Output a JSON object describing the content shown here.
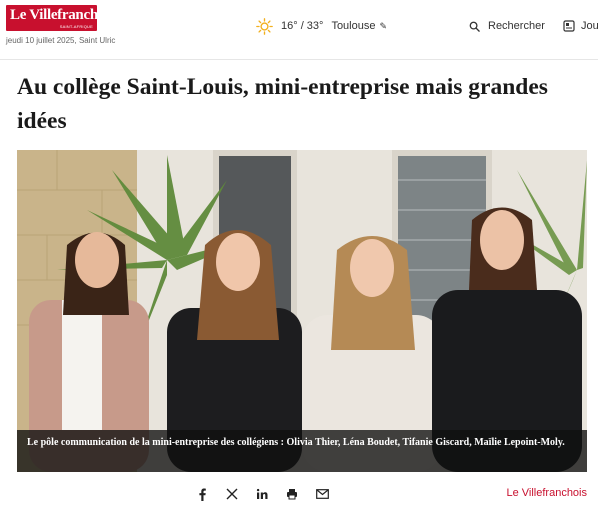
{
  "header": {
    "logo_text": "Le Villefranchois",
    "logo_sub": "SAINT-AFRIQUE",
    "dateline": "jeudi 10 juillet 2025, Saint Ulric",
    "weather": {
      "temps": "16° / 33°",
      "city": "Toulouse"
    },
    "search_label": "Rechercher",
    "journal_label": "Jou"
  },
  "article": {
    "title": "Au collège Saint-Louis, mini-entreprise mais grandes idées",
    "caption": "Le pôle communication de la mini-entreprise des collégiens : Olivia Thier, Léna Boudet, Tifanie Giscard, Maïlie Lepoint-Moly."
  },
  "share": {
    "icons": [
      "facebook-icon",
      "x-icon",
      "linkedin-icon",
      "print-icon",
      "email-icon"
    ],
    "brand": "Le Villefranchois"
  },
  "colors": {
    "brand": "#c8102e",
    "accent_sun": "#f2b01e"
  }
}
